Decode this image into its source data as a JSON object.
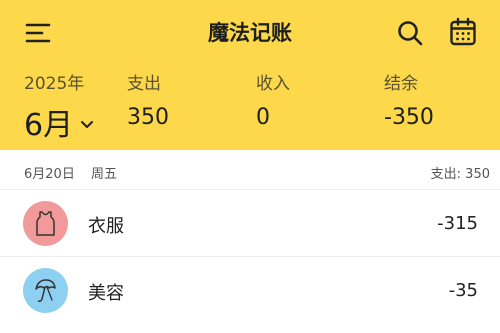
{
  "app": {
    "title": "魔法记账"
  },
  "summary": {
    "year": "2025年",
    "month": "6月",
    "expense_label": "支出",
    "expense_value": "350",
    "income_label": "收入",
    "income_value": "0",
    "balance_label": "结余",
    "balance_value": "-350"
  },
  "day": {
    "date": "6月20日",
    "weekday": "周五",
    "total": "支出: 350"
  },
  "items": [
    {
      "name": "衣服",
      "amount": "-315",
      "icon": "tank-top-icon",
      "color": "#f29a9a"
    },
    {
      "name": "美容",
      "amount": "-35",
      "icon": "umbrella-icon",
      "color": "#8ed0f2"
    }
  ],
  "colors": {
    "header": "#fcd84a"
  }
}
